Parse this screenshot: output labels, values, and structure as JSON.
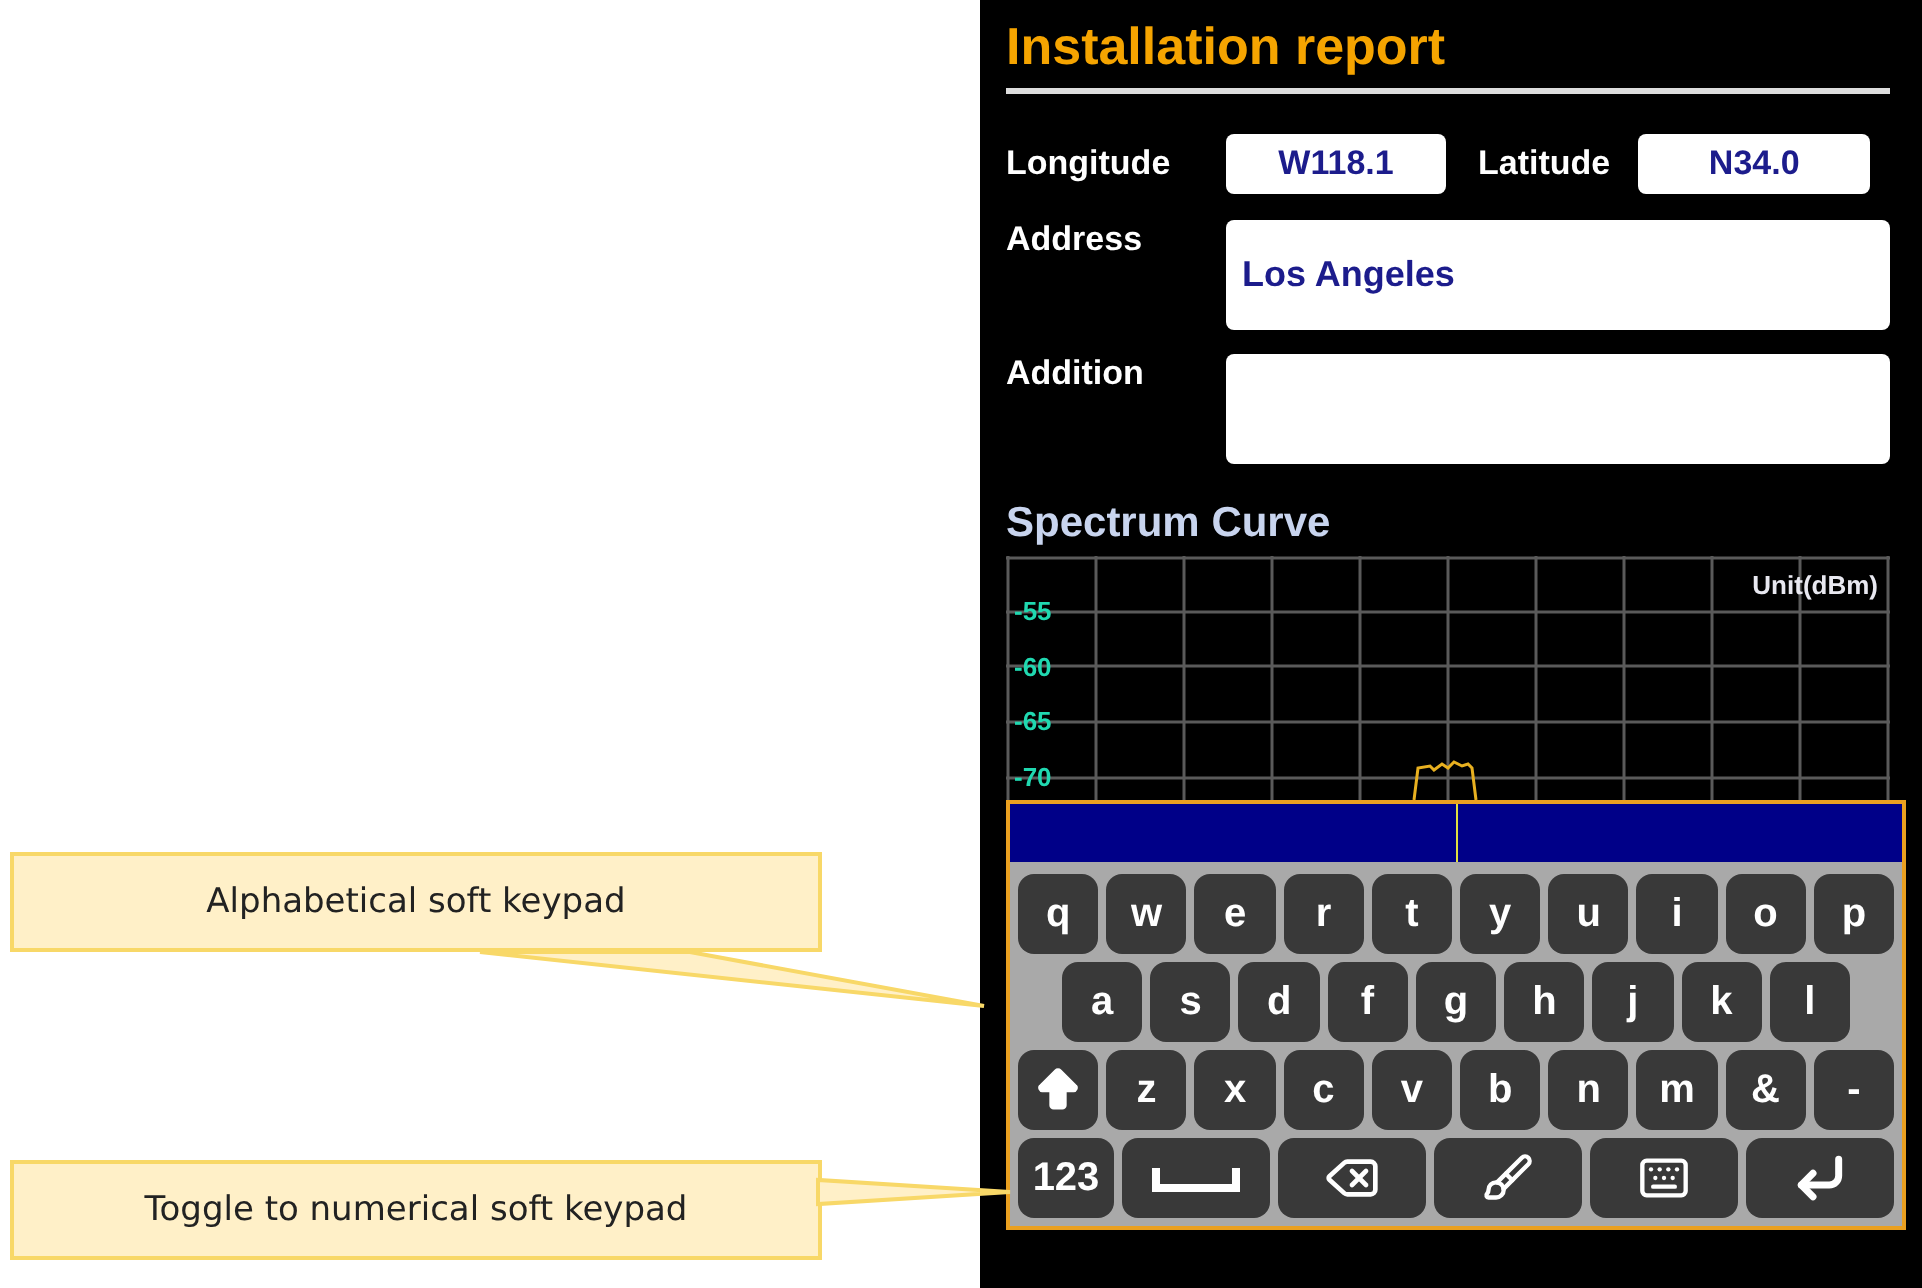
{
  "callouts": [
    {
      "text": "Alphabetical soft keypad"
    },
    {
      "text": "Toggle to numerical soft keypad"
    }
  ],
  "screen": {
    "title": "Installation report",
    "coordinates": [
      {
        "label": "Longitude",
        "value": "W118.1"
      },
      {
        "label": "Latitude",
        "value": "N34.0"
      }
    ],
    "fields": [
      {
        "label": "Address",
        "value": "Los Angeles"
      },
      {
        "label": "Addition"
      }
    ],
    "spectrum": {
      "title": "Spectrum Curve",
      "unit": "Unit(dBm)",
      "y_labels": [
        "-55",
        "-60",
        "-65",
        "-70"
      ]
    },
    "keyboard": {
      "rows": [
        [
          {
            "kind": "char",
            "label": "q"
          },
          {
            "kind": "char",
            "label": "w"
          },
          {
            "kind": "char",
            "label": "e"
          },
          {
            "kind": "char",
            "label": "r"
          },
          {
            "kind": "char",
            "label": "t"
          },
          {
            "kind": "char",
            "label": "y"
          },
          {
            "kind": "char",
            "label": "u"
          },
          {
            "kind": "char",
            "label": "i"
          },
          {
            "kind": "char",
            "label": "o"
          },
          {
            "kind": "char",
            "label": "p"
          }
        ],
        [
          {
            "kind": "char",
            "label": "a"
          },
          {
            "kind": "char",
            "label": "s"
          },
          {
            "kind": "char",
            "label": "d"
          },
          {
            "kind": "char",
            "label": "f"
          },
          {
            "kind": "char",
            "label": "g"
          },
          {
            "kind": "char",
            "label": "h"
          },
          {
            "kind": "char",
            "label": "j"
          },
          {
            "kind": "char",
            "label": "k"
          },
          {
            "kind": "char",
            "label": "l"
          }
        ],
        [
          {
            "kind": "shift"
          },
          {
            "kind": "char",
            "label": "z"
          },
          {
            "kind": "char",
            "label": "x"
          },
          {
            "kind": "char",
            "label": "c"
          },
          {
            "kind": "char",
            "label": "v"
          },
          {
            "kind": "char",
            "label": "b"
          },
          {
            "kind": "char",
            "label": "n"
          },
          {
            "kind": "char",
            "label": "m"
          },
          {
            "kind": "char",
            "label": "&"
          },
          {
            "kind": "char",
            "label": "-"
          }
        ],
        [
          {
            "kind": "toggle",
            "label": "123"
          },
          {
            "kind": "space"
          },
          {
            "kind": "backspace"
          },
          {
            "kind": "clear"
          },
          {
            "kind": "hide"
          },
          {
            "kind": "enter"
          }
        ]
      ]
    }
  }
}
